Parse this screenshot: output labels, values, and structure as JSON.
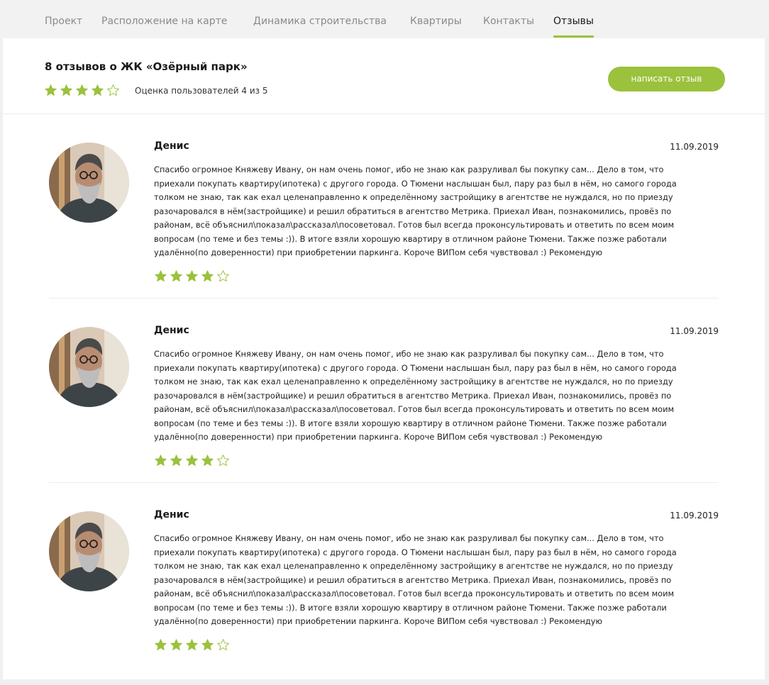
{
  "tabs": [
    {
      "label": "Проект"
    },
    {
      "label": "Расположение на карте"
    },
    {
      "label": "Динамика строительства"
    },
    {
      "label": "Квартиры"
    },
    {
      "label": "Контакты"
    },
    {
      "label": "Отзывы"
    }
  ],
  "active_tab": "Отзывы",
  "summary": {
    "title": "8 отзывов о ЖК «Озёрный парк»",
    "rating_text": "Оценка пользователей 4 из 5",
    "rating": 4,
    "rating_max": 5,
    "write_button": "написать отзыв"
  },
  "colors": {
    "accent": "#9ac23c",
    "star_filled": "#9ac23c",
    "star_empty_outline": "#9ac23c"
  },
  "icons": {
    "star_filled": "star-filled-icon",
    "star_empty": "star-outline-icon"
  },
  "reviews": [
    {
      "author": "Денис",
      "date": "11.09.2019",
      "rating": 4,
      "text": "Спасибо огромное Княжеву Ивану, он нам очень помог, ибо не знаю как разруливал бы покупку сам... Дело в том, что приехали покупать квартиру(ипотека) с другого города. О Тюмени наслышан был, пару раз был в нём, но самого города толком не знаю, так как ехал целенаправленно к определённому застройщику в агентстве не нуждался, но по приезду разочаровался в нём(застройщике) и решил обратиться в агентство Метрика. Приехал Иван, познакомились, провёз по районам, всё объяснил\\показал\\рассказал\\посоветовал. Готов был всегда проконсультировать и ответить по всем моим вопросам (по теме и без темы :)). В итоге взяли хорошую квартиру в отличном районе Тюмени. Также позже работали удалённо(по доверенности) при приобретении паркинга. Короче ВИПом себя чувствовал :) Рекомендую"
    },
    {
      "author": "Денис",
      "date": "11.09.2019",
      "rating": 4,
      "text": "Спасибо огромное Княжеву Ивану, он нам очень помог, ибо не знаю как разруливал бы покупку сам... Дело в том, что приехали покупать квартиру(ипотека) с другого города. О Тюмени наслышан был, пару раз был в нём, но самого города толком не знаю, так как ехал целенаправленно к определённому застройщику в агентстве не нуждался, но по приезду разочаровался в нём(застройщике) и решил обратиться в агентство Метрика. Приехал Иван, познакомились, провёз по районам, всё объяснил\\показал\\рассказал\\посоветовал. Готов был всегда проконсультировать и ответить по всем моим вопросам (по теме и без темы :)). В итоге взяли хорошую квартиру в отличном районе Тюмени. Также позже работали удалённо(по доверенности) при приобретении паркинга. Короче ВИПом себя чувствовал :) Рекомендую"
    },
    {
      "author": "Денис",
      "date": "11.09.2019",
      "rating": 4,
      "text": "Спасибо огромное Княжеву Ивану, он нам очень помог, ибо не знаю как разруливал бы покупку сам... Дело в том, что приехали покупать квартиру(ипотека) с другого города. О Тюмени наслышан был, пару раз был в нём, но самого города толком не знаю, так как ехал целенаправленно к определённому застройщику в агентстве не нуждался, но по приезду разочаровался в нём(застройщике) и решил обратиться в агентство Метрика. Приехал Иван, познакомились, провёз по районам, всё объяснил\\показал\\рассказал\\посоветовал. Готов был всегда проконсультировать и ответить по всем моим вопросам (по теме и без темы :)). В итоге взяли хорошую квартиру в отличном районе Тюмени. Также позже работали удалённо(по доверенности) при приобретении паркинга. Короче ВИПом себя чувствовал :) Рекомендую"
    }
  ]
}
